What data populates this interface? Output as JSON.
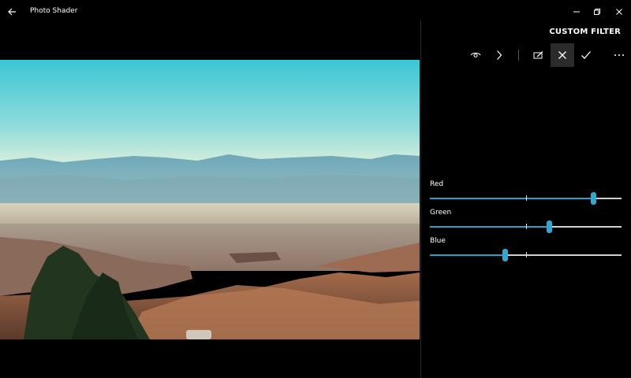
{
  "app": {
    "title": "Photo Shader"
  },
  "panel": {
    "title": "CUSTOM FILTER"
  },
  "toolbar": {
    "icons": [
      "eye-icon",
      "chevron-right-icon",
      "edit-icon",
      "close-icon",
      "checkmark-icon",
      "more-icon"
    ]
  },
  "sliders": [
    {
      "label": "Red",
      "value": 0.85
    },
    {
      "label": "Green",
      "value": 0.62
    },
    {
      "label": "Blue",
      "value": 0.39
    }
  ],
  "colors": {
    "accent": "#2ea9cf",
    "background": "#000000",
    "track": "#d0d0d0"
  }
}
